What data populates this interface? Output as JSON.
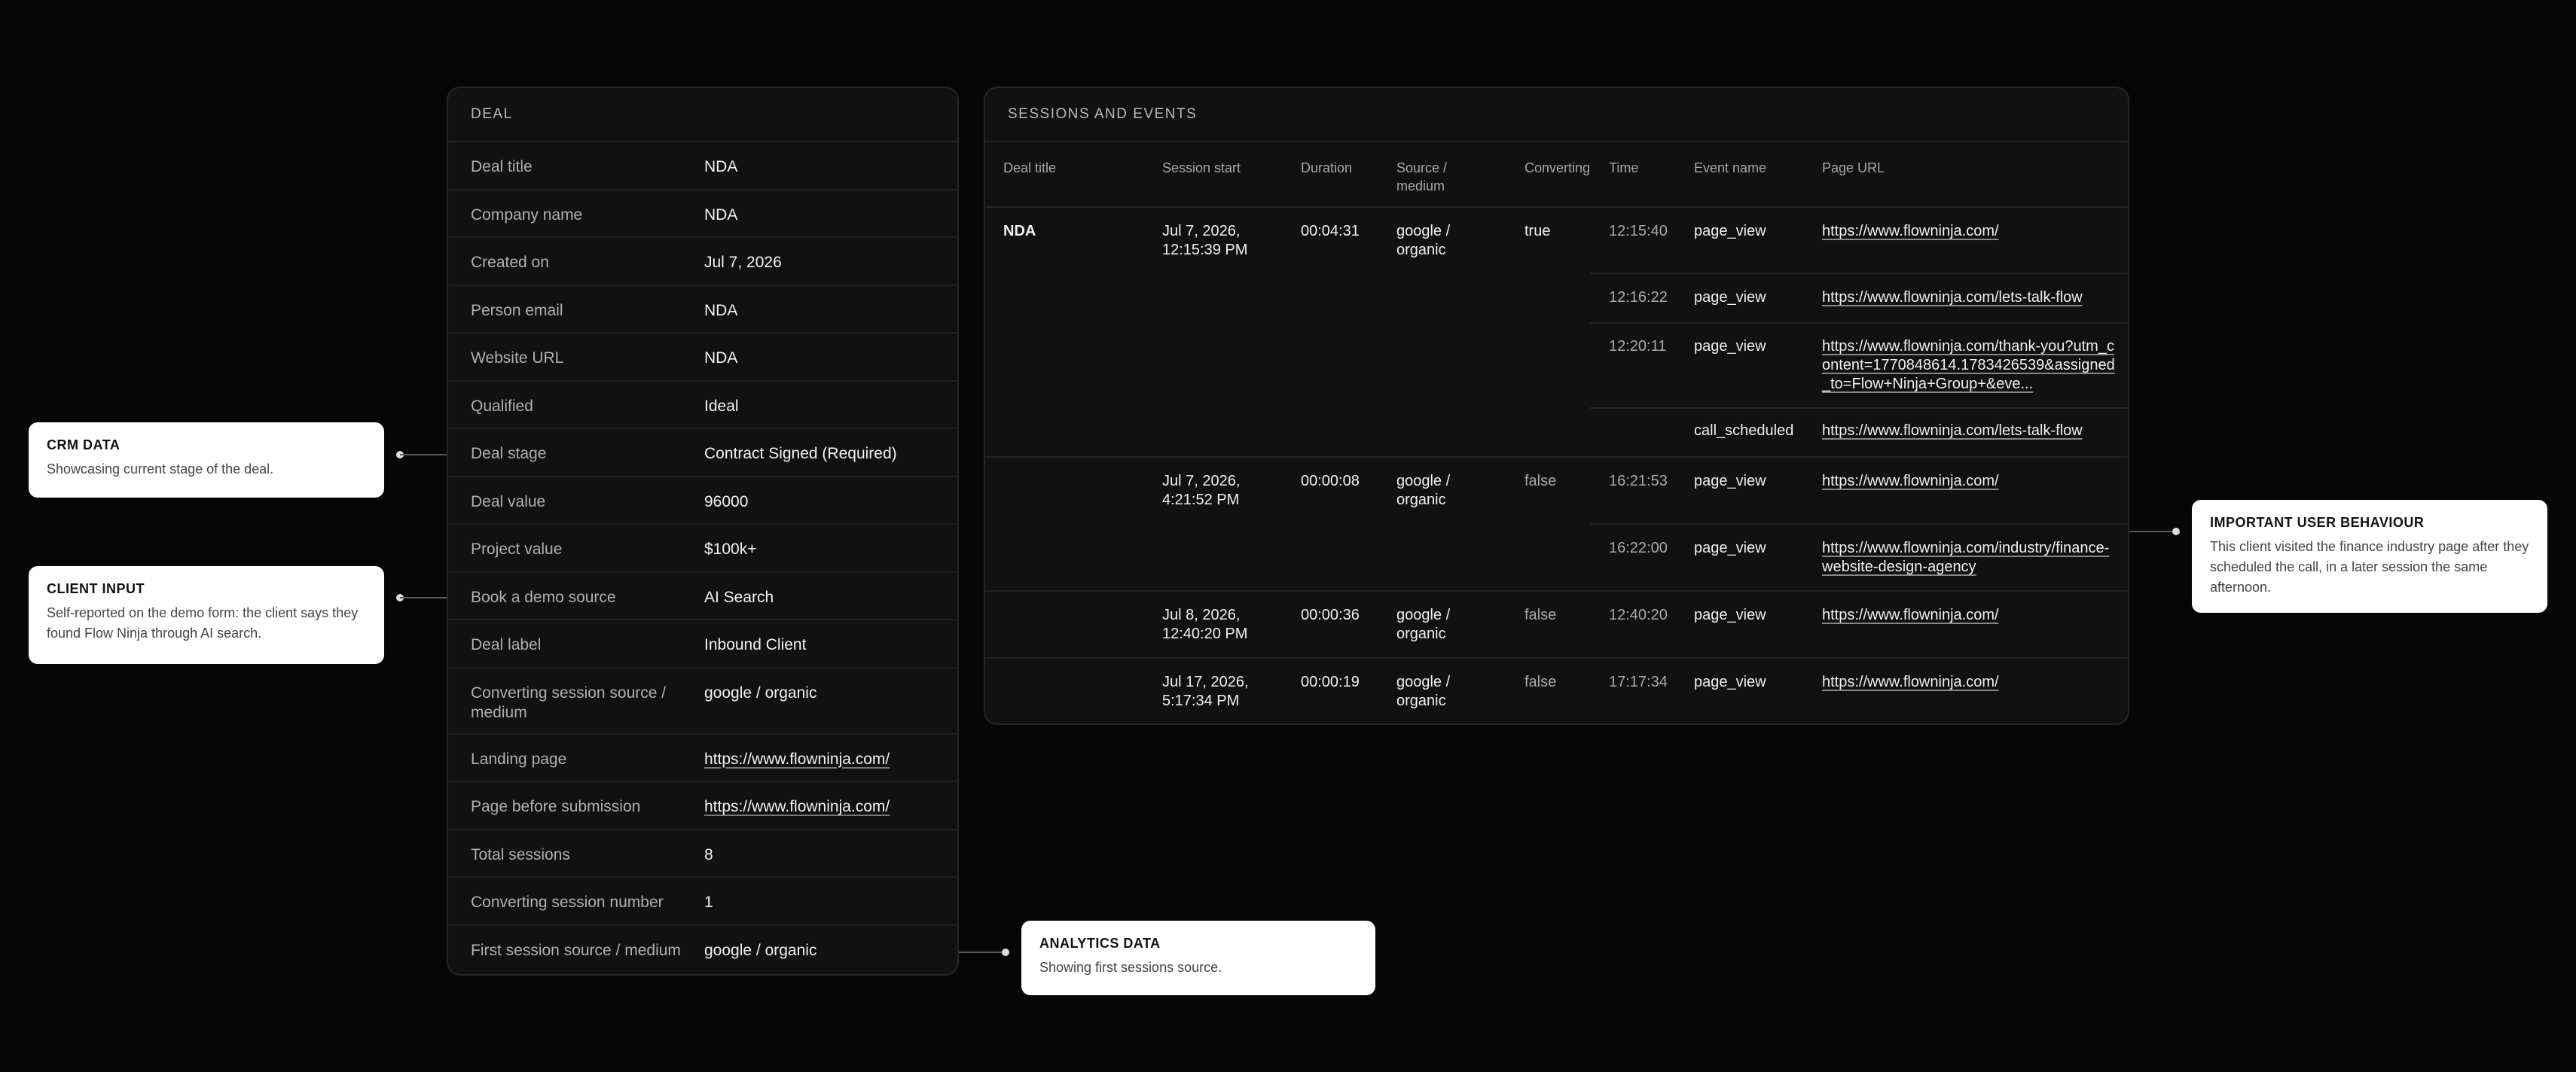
{
  "deal": {
    "header": "DEAL",
    "rows": [
      {
        "key": "Deal title",
        "value": "NDA"
      },
      {
        "key": "Company name",
        "value": "NDA"
      },
      {
        "key": "Created on",
        "value": "Jul 7, 2026"
      },
      {
        "key": "Person email",
        "value": "NDA"
      },
      {
        "key": "Website URL",
        "value": "NDA"
      },
      {
        "key": "Qualified",
        "value": "Ideal"
      },
      {
        "key": "Deal stage",
        "value": "Contract Signed (Required)"
      },
      {
        "key": "Deal value",
        "value": "96000"
      },
      {
        "key": "Project value",
        "value": "$100k+"
      },
      {
        "key": "Book a demo source",
        "value": "AI Search"
      },
      {
        "key": "Deal label",
        "value": "Inbound Client"
      },
      {
        "key": "Converting session source / medium",
        "value": "google / organic"
      },
      {
        "key": "Landing page",
        "value": "https://www.flowninja.com/"
      },
      {
        "key": "Page before submission",
        "value": "https://www.flowninja.com/"
      },
      {
        "key": "Total sessions",
        "value": "8"
      },
      {
        "key": "Converting session number",
        "value": "1"
      },
      {
        "key": "First session source / medium",
        "value": "google / organic"
      }
    ]
  },
  "sessions": {
    "header": "SESSIONS AND EVENTS",
    "columns": [
      "Deal title",
      "Session start",
      "Duration",
      "Source / medium",
      "Converting",
      "Time",
      "Event name",
      "Page URL"
    ],
    "deal_title": "NDA",
    "groups": [
      {
        "session_start": "Jul 7, 2026, 12:15:39 PM",
        "duration": "00:04:31",
        "source": "google / organic",
        "converting": "true",
        "events": [
          {
            "time": "12:15:40",
            "name": "page_view",
            "url": "https://www.flowninja.com/"
          },
          {
            "time": "12:16:22",
            "name": "page_view",
            "url": "https://www.flowninja.com/lets-talk-flow"
          },
          {
            "time": "12:20:11",
            "name": "page_view",
            "url": "https://www.flowninja.com/thank-you?utm_content=1770848614.1783426539&assigned_to=Flow+Ninja+Group+&eve..."
          },
          {
            "time": "",
            "name": "call_scheduled",
            "url": "https://www.flowninja.com/lets-talk-flow"
          }
        ]
      },
      {
        "session_start": "Jul 7, 2026, 4:21:52 PM",
        "duration": "00:00:08",
        "source": "google / organic",
        "converting": "false",
        "events": [
          {
            "time": "16:21:53",
            "name": "page_view",
            "url": "https://www.flowninja.com/"
          },
          {
            "time": "16:22:00",
            "name": "page_view",
            "url": "https://www.flowninja.com/industry/finance-website-design-agency"
          }
        ]
      },
      {
        "session_start": "Jul 8, 2026, 12:40:20 PM",
        "duration": "00:00:36",
        "source": "google / organic",
        "converting": "false",
        "events": [
          {
            "time": "12:40:20",
            "name": "page_view",
            "url": "https://www.flowninja.com/"
          }
        ]
      },
      {
        "session_start": "Jul 17, 2026, 5:17:34 PM",
        "duration": "00:00:19",
        "source": "google / organic",
        "converting": "false",
        "events": [
          {
            "time": "17:17:34",
            "name": "page_view",
            "url": "https://www.flowninja.com/"
          }
        ]
      }
    ]
  },
  "callouts": {
    "crm": {
      "title": "CRM DATA",
      "desc": "Showcasing current stage of the deal."
    },
    "client": {
      "title": "CLIENT INPUT",
      "desc": "Self-reported on the demo form: the client says they found Flow Ninja through AI search."
    },
    "analytics": {
      "title": "ANALYTICS DATA",
      "desc": "Showing first sessions source."
    },
    "behaviour": {
      "title": "IMPORTANT USER BEHAVIOUR",
      "desc": "This client visited the finance industry page after they scheduled the call, in a later session the same afternoon."
    }
  }
}
